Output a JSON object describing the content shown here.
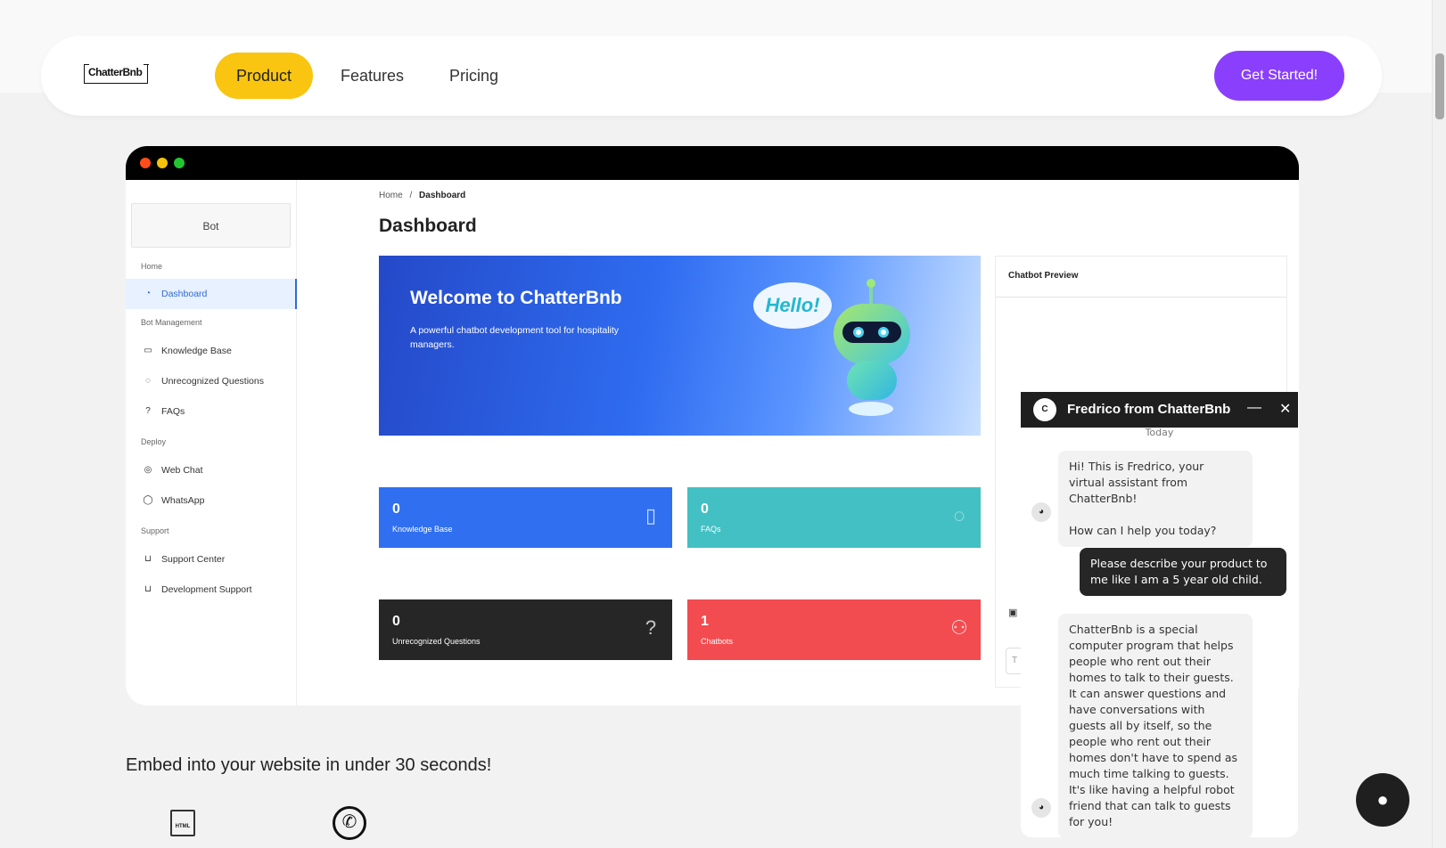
{
  "nav": {
    "logo": "ChatterBnb",
    "items": [
      "Product",
      "Features",
      "Pricing"
    ],
    "cta": "Get Started!"
  },
  "app": {
    "sidebar": {
      "bot_label": "Bot",
      "sections": {
        "home": "Home",
        "bot_management": "Bot Management",
        "deploy": "Deploy",
        "support": "Support"
      },
      "items": {
        "dashboard": "Dashboard",
        "knowledge_base": "Knowledge Base",
        "unrecognized_questions": "Unrecognized Questions",
        "faqs": "FAQs",
        "web_chat": "Web Chat",
        "whatsapp": "WhatsApp",
        "support_center": "Support Center",
        "development_support": "Development Support"
      }
    },
    "breadcrumb": {
      "home": "Home",
      "sep": "/",
      "current": "Dashboard"
    },
    "page_title": "Dashboard",
    "hero": {
      "title": "Welcome to ChatterBnb",
      "subtitle": "A powerful chatbot development tool for hospitality managers.",
      "bubble": "Hello!"
    },
    "cards": {
      "knowledge_base": {
        "value": "0",
        "label": "Knowledge Base"
      },
      "faqs": {
        "value": "0",
        "label": "FAQs"
      },
      "unrecognized": {
        "value": "0",
        "label": "Unrecognized Questions"
      },
      "chatbots": {
        "value": "1",
        "label": "Chatbots"
      }
    },
    "preview_title": "Chatbot Preview",
    "preview_input_placeholder": "T"
  },
  "embed": {
    "title": "Embed into your website in under 30 seconds!",
    "html_icon_label": "HTML"
  },
  "chat": {
    "title": "Fredrico from ChatterBnb",
    "logo": "C",
    "minimize": "—",
    "close": "✕",
    "date": "Today",
    "messages": [
      {
        "from": "bot",
        "text": "Hi! This is Fredrico, your virtual assistant from ChatterBnb!\n\nHow can I help you today?"
      },
      {
        "from": "user",
        "text": "Please describe your product to me like I am a 5 year old child."
      },
      {
        "from": "bot",
        "text": "ChatterBnb is a special computer program that helps people who rent out their homes to talk to their guests. It can answer questions and have conversations with guests all by itself, so the people who rent out their homes don't have to spend as much time talking to guests. It's like having a helpful robot friend that can talk to guests for you!"
      }
    ]
  },
  "colors": {
    "accent_yellow": "#f9c510",
    "cta_purple": "#8a3ffc",
    "card_blue": "#2f6ff0",
    "card_teal": "#43c0c3",
    "card_dark": "#262626",
    "card_red": "#f24c50"
  },
  "icons": {
    "dashboard": "gauge-icon",
    "knowledge_base": "book-icon",
    "unrecognized": "chat-question-icon",
    "faqs": "question-circle-icon",
    "web_chat": "globe-icon",
    "whatsapp": "whatsapp-icon",
    "support": "cart-icon",
    "chatbots": "nodes-icon"
  }
}
